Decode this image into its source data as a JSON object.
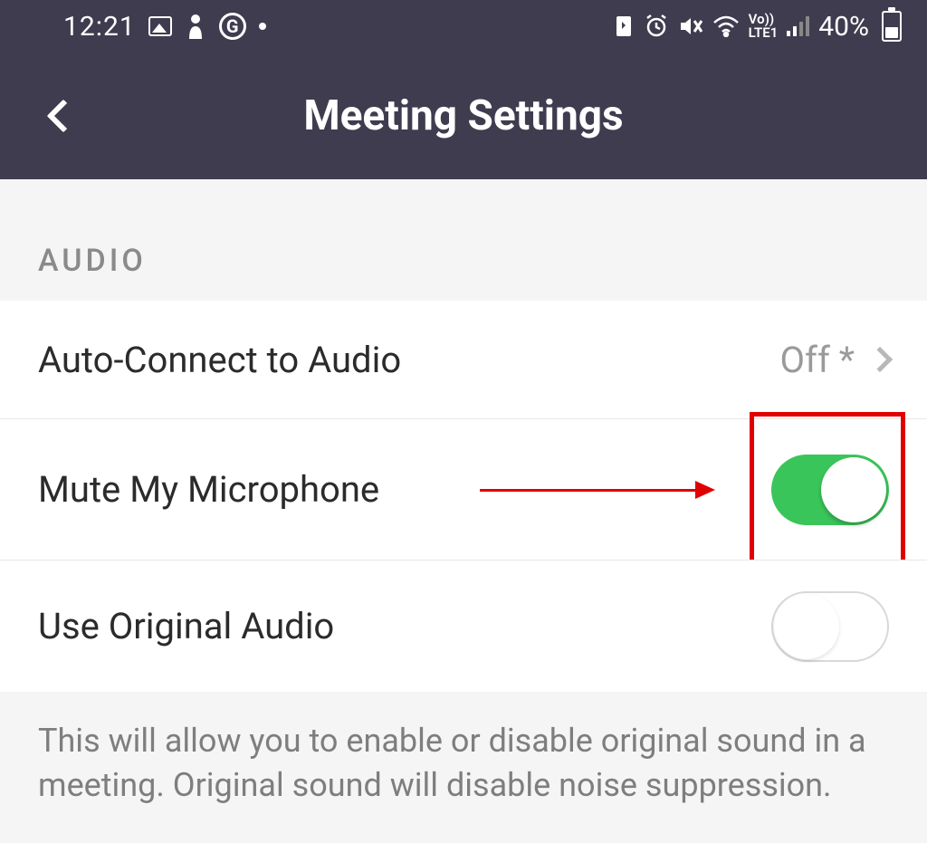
{
  "status": {
    "time": "12:21",
    "battery_text": "40%",
    "lte_label": "Vo))\nLTE1"
  },
  "header": {
    "title": "Meeting Settings"
  },
  "section": {
    "audio_label": "AUDIO"
  },
  "settings": {
    "auto_connect": {
      "label": "Auto-Connect to Audio",
      "value": "Off *"
    },
    "mute_mic": {
      "label": "Mute My Microphone",
      "enabled": true
    },
    "original_audio": {
      "label": "Use Original Audio",
      "enabled": false
    },
    "original_audio_desc": "This will allow you to enable or disable original sound in a meeting. Original sound will disable noise suppression."
  }
}
